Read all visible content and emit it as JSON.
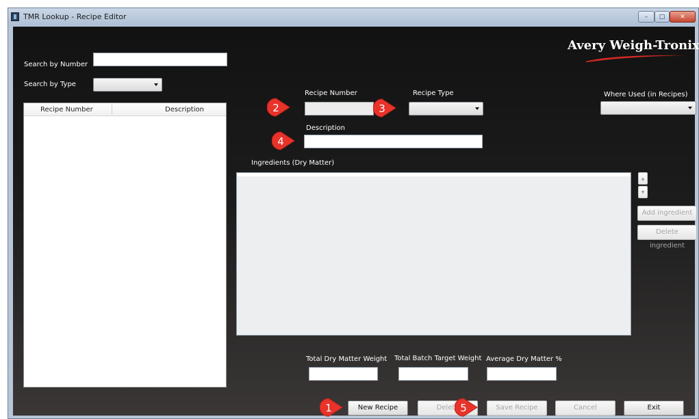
{
  "window": {
    "title": "TMR Lookup - Recipe Editor",
    "min_glyph": "–",
    "max_glyph": "□",
    "close_glyph": "✕"
  },
  "logo": {
    "text": "Avery Weigh-Tronix"
  },
  "search": {
    "by_number_label": "Search by Number",
    "by_number_value": "",
    "by_type_label": "Search by Type",
    "by_type_value": ""
  },
  "recipe_list": {
    "columns": [
      "Recipe Number",
      "Description"
    ],
    "rows": []
  },
  "form": {
    "recipe_number_label": "Recipe Number",
    "recipe_number_value": "",
    "recipe_type_label": "Recipe Type",
    "recipe_type_value": "",
    "where_used_label": "Where Used (in Recipes)",
    "where_used_value": "",
    "description_label": "Description",
    "description_value": "",
    "ingredients_label": "Ingredients (Dry Matter)"
  },
  "ingredient_actions": {
    "add": "Add ingredient",
    "delete": "Delete ingredient",
    "up_glyph": "▲",
    "down_glyph": "▼"
  },
  "totals": {
    "dry_matter_weight_label": "Total Dry Matter Weight",
    "dry_matter_weight_value": "",
    "batch_target_weight_label": "Total Batch Target Weight",
    "batch_target_weight_value": "",
    "avg_dry_matter_label": "Average Dry Matter %",
    "avg_dry_matter_value": ""
  },
  "actions": {
    "new_recipe": "New Recipe",
    "delete": "Delete",
    "save_recipe": "Save Recipe",
    "cancel": "Cancel",
    "exit": "Exit"
  },
  "markers": {
    "m1": "1",
    "m2": "2",
    "m3": "3",
    "m4": "4",
    "m5": "5"
  },
  "colors": {
    "marker": "#e8332a",
    "background_top": "#121212",
    "background_bottom": "#3a3736",
    "logo_swoosh": "#d42a23"
  }
}
